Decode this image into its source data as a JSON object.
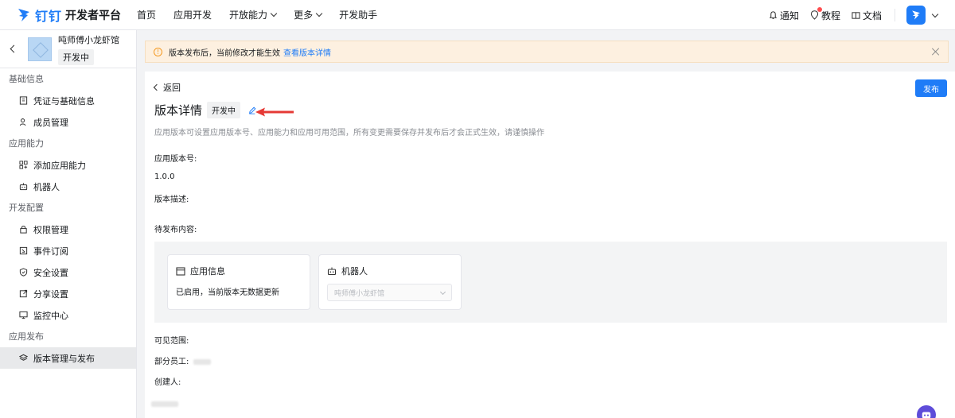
{
  "header": {
    "logo_text": "钉钉",
    "logo_sub": "开发者平台",
    "nav": [
      {
        "label": "首页"
      },
      {
        "label": "应用开发"
      },
      {
        "label": "开放能力",
        "dropdown": true
      },
      {
        "label": "更多",
        "dropdown": true
      },
      {
        "label": "开发助手"
      }
    ],
    "right": {
      "notify": "通知",
      "tutorial": "教程",
      "docs": "文档"
    },
    "colors": {
      "brand": "#1f7cf7"
    }
  },
  "sidebar": {
    "app_name": "吨师傅小龙虾馆",
    "app_status": "开发中",
    "sections": [
      {
        "title": "基础信息",
        "items": [
          {
            "label": "凭证与基础信息",
            "icon": "credential-icon"
          },
          {
            "label": "成员管理",
            "icon": "member-icon"
          }
        ]
      },
      {
        "title": "应用能力",
        "items": [
          {
            "label": "添加应用能力",
            "icon": "grid-add-icon"
          },
          {
            "label": "机器人",
            "icon": "robot-icon"
          }
        ]
      },
      {
        "title": "开发配置",
        "items": [
          {
            "label": "权限管理",
            "icon": "lock-icon"
          },
          {
            "label": "事件订阅",
            "icon": "event-icon"
          },
          {
            "label": "安全设置",
            "icon": "shield-icon"
          },
          {
            "label": "分享设置",
            "icon": "share-icon"
          },
          {
            "label": "监控中心",
            "icon": "monitor-icon"
          }
        ]
      },
      {
        "title": "应用发布",
        "items": [
          {
            "label": "版本管理与发布",
            "icon": "layers-icon",
            "active": true
          }
        ]
      }
    ]
  },
  "banner": {
    "text": "版本发布后，当前修改才能生效",
    "link": "查看版本详情"
  },
  "main": {
    "back": "返回",
    "publish": "发布",
    "title": "版本详情",
    "status": "开发中",
    "description": "应用版本可设置应用版本号、应用能力和应用可用范围，所有变更需要保存并发布后才会正式生效，请谨慎操作",
    "version_label": "应用版本号:",
    "version_value": "1.0.0",
    "version_desc_label": "版本描述:",
    "pending_label": "待发布内容:",
    "app_info_card": {
      "title": "应用信息",
      "text": "已启用，当前版本无数据更新"
    },
    "robot_card": {
      "title": "机器人",
      "select_value": "吨师傅小龙虾馆"
    },
    "visible_label": "可见范围:",
    "partial_staff_label": "部分员工:",
    "creator_label": "创建人:"
  }
}
